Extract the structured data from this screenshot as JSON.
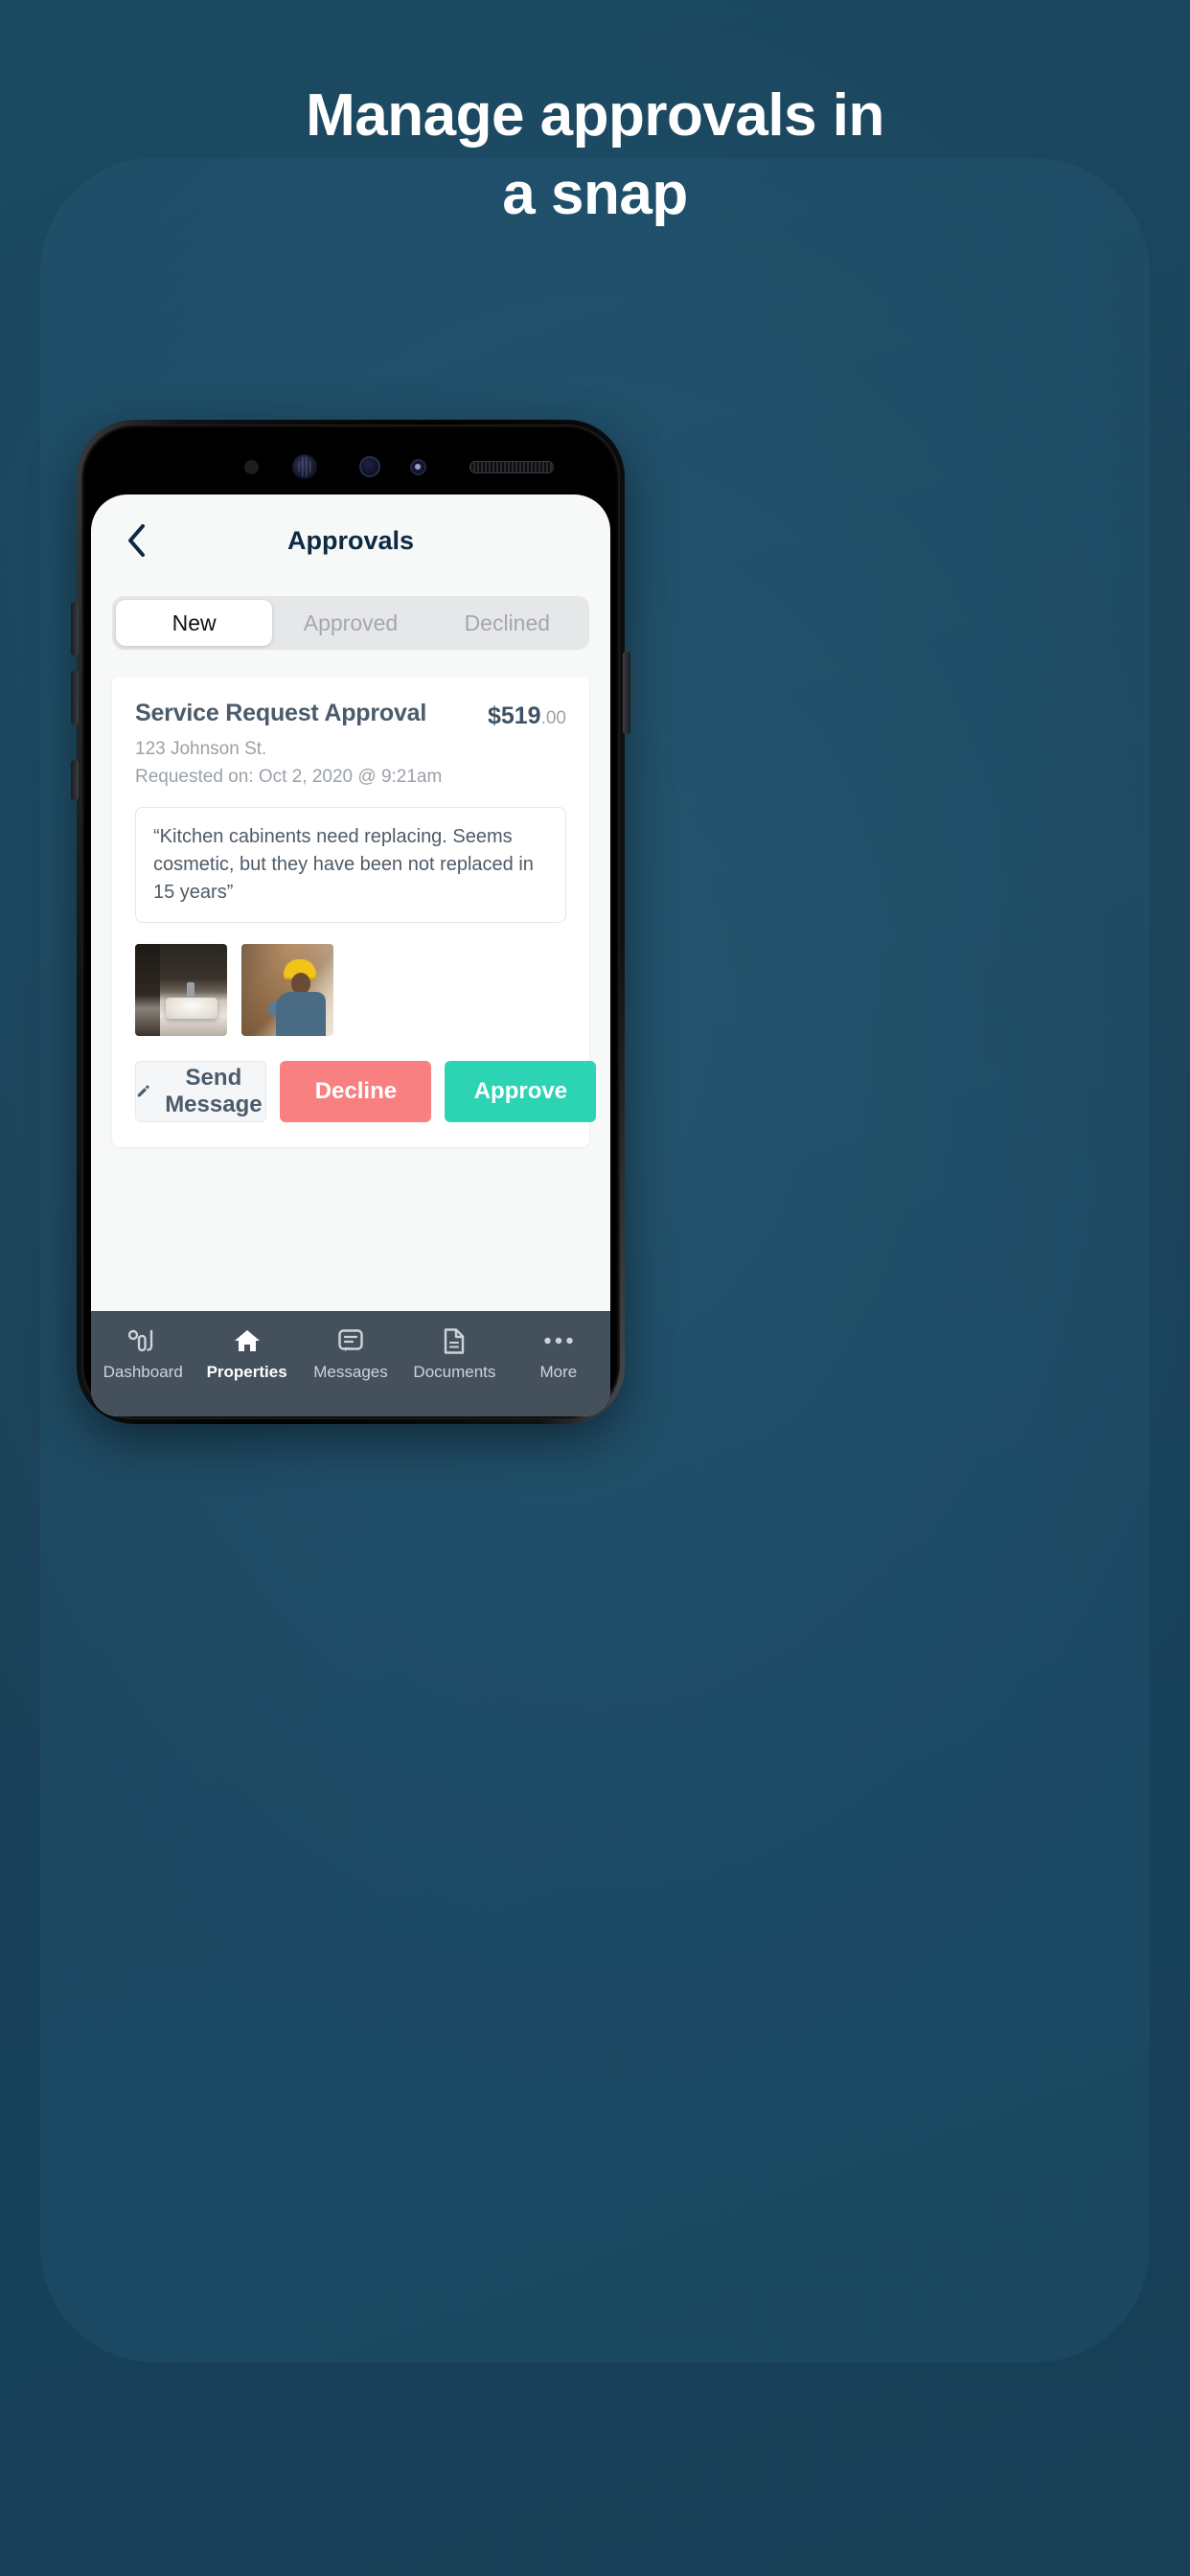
{
  "headline": {
    "line1": "Manage approvals in",
    "line2": "a snap"
  },
  "app": {
    "title": "Approvals",
    "back_icon": "chevron-left-icon"
  },
  "tabs": [
    {
      "label": "New",
      "active": true
    },
    {
      "label": "Approved",
      "active": false
    },
    {
      "label": "Declined",
      "active": false
    }
  ],
  "request": {
    "title": "Service Request Approval",
    "price_major": "$519",
    "price_minor": ".00",
    "address": "123 Johnson St.",
    "requested_on": "Requested on: Oct 2, 2020 @ 9:21am",
    "note": "“Kitchen cabinents need replacing. Seems cosmetic, but they have been not replaced in 15 years”",
    "photos": [
      {
        "alt": "bathroom-vanity-photo"
      },
      {
        "alt": "worker-hard-hat-photo"
      }
    ],
    "actions": {
      "message_label": "Send Message",
      "message_icon": "pencil-icon",
      "decline_label": "Decline",
      "approve_label": "Approve"
    }
  },
  "bottom_nav": [
    {
      "label": "Dashboard",
      "icon": "bar-chart-icon",
      "active": false
    },
    {
      "label": "Properties",
      "icon": "home-icon",
      "active": true
    },
    {
      "label": "Messages",
      "icon": "chat-bubble-icon",
      "active": false
    },
    {
      "label": "Documents",
      "icon": "document-icon",
      "active": false
    },
    {
      "label": "More",
      "icon": "ellipsis-icon",
      "active": false
    }
  ],
  "colors": {
    "background": "#1b4157",
    "title": "#0d2a42",
    "decline": "#f98080",
    "approve": "#2dd4b4",
    "nav_bar": "#44515c"
  }
}
